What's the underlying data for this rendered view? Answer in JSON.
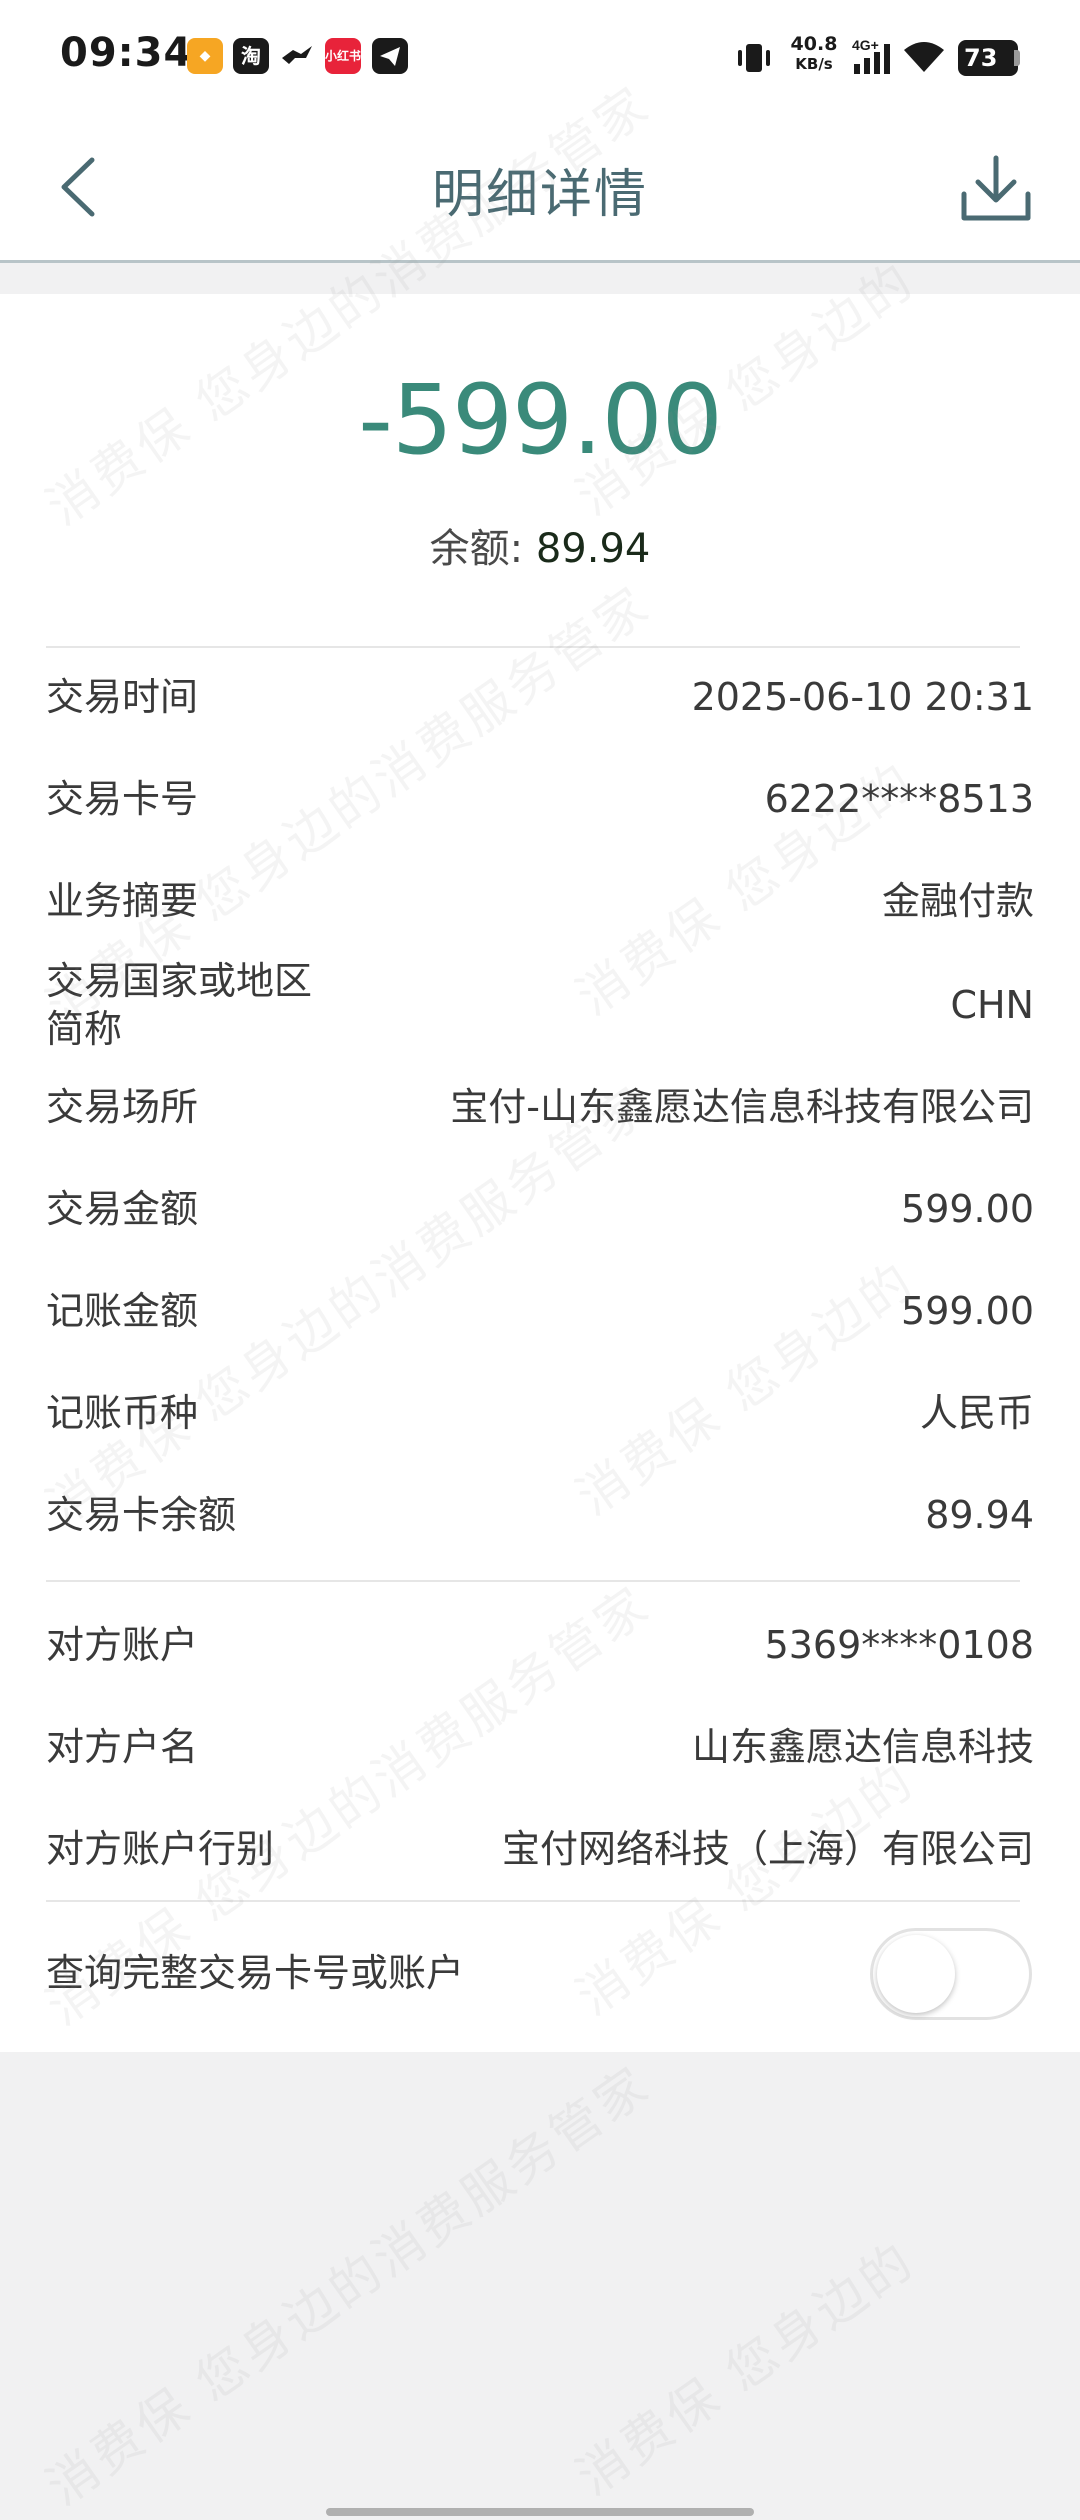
{
  "status_bar": {
    "time": "09:34",
    "net_speed": "40.8",
    "net_unit": "KB/s",
    "network_type": "4G+",
    "battery": "73",
    "apps": [
      "taobao-icon",
      "xiaohongshu-icon",
      "telegram-icon"
    ]
  },
  "header": {
    "title": "明细详情"
  },
  "summary": {
    "amount": "-599.00",
    "balance_label": "余额:",
    "balance_value": "89.94"
  },
  "details": [
    {
      "label": "交易时间",
      "value": "2025-06-10 20:31"
    },
    {
      "label": "交易卡号",
      "value": "6222****8513"
    },
    {
      "label": "业务摘要",
      "value": "金融付款"
    },
    {
      "label": "交易国家或地区",
      "label2": "简称",
      "value": "CHN"
    },
    {
      "label": "交易场所",
      "value": "宝付-山东鑫愿达信息科技有限公司"
    },
    {
      "label": "交易金额",
      "value": "599.00"
    },
    {
      "label": "记账金额",
      "value": "599.00"
    },
    {
      "label": "记账币种",
      "value": "人民币"
    },
    {
      "label": "交易卡余额",
      "value": "89.94"
    }
  ],
  "counterparty": [
    {
      "label": "对方账户",
      "value": "5369****0108"
    },
    {
      "label": "对方户名",
      "value": "山东鑫愿达信息科技"
    },
    {
      "label": "对方账户行别",
      "value": "宝付网络科技（上海）有限公司"
    }
  ],
  "toggle_row": {
    "label": "查询完整交易卡号或账户",
    "enabled": false
  },
  "watermark": {
    "text_a": "消费保 您身边的消费服务管家",
    "text_b": "消费保 您身边的"
  },
  "colors": {
    "amount": "#3a8a7a",
    "title": "#4a6a72",
    "background": "#f1f1f2"
  }
}
